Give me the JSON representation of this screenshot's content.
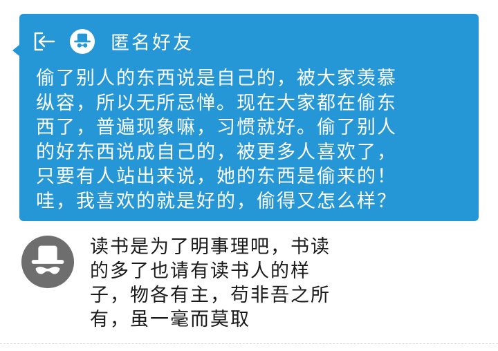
{
  "chat": {
    "contact_name": "匿名好友",
    "message": "偷了别人的东西说是自己的，被大家羡慕\n纵容，所以无所忌惮。现在大家都在偷东\n西了，普遍现象嘛，习惯就好。偷了别人\n的好东西说成自己的，被更多人喜欢了，\n只要有人站出来说，她的东西是偷来的！\n哇，我喜欢的就是好的，偷得又怎么样？"
  },
  "reply": {
    "text": "读书是为了明事理吧，书读\n的多了也请有读书人的样\n子，物各有主，苟非吾之所\n有，虽一毫而莫取"
  },
  "icons": {
    "back": "exit-arrow-icon",
    "avatar": "anonymous-hat-glasses-avatar"
  },
  "colors": {
    "bubble": "#2596d6",
    "avatar_gray": "#6e6e6e"
  }
}
